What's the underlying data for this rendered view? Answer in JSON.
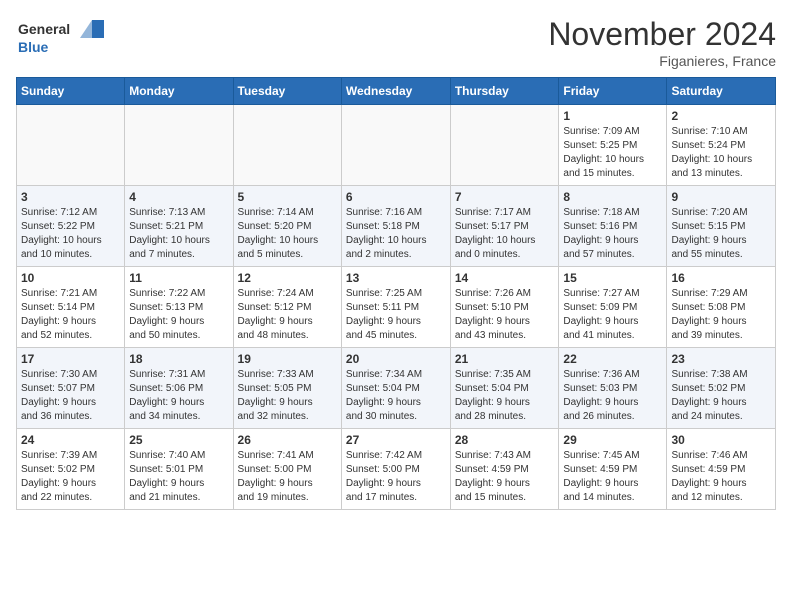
{
  "header": {
    "logo_line1": "General",
    "logo_line2": "Blue",
    "month": "November 2024",
    "location": "Figanieres, France"
  },
  "days_of_week": [
    "Sunday",
    "Monday",
    "Tuesday",
    "Wednesday",
    "Thursday",
    "Friday",
    "Saturday"
  ],
  "weeks": [
    [
      {
        "day": "",
        "info": ""
      },
      {
        "day": "",
        "info": ""
      },
      {
        "day": "",
        "info": ""
      },
      {
        "day": "",
        "info": ""
      },
      {
        "day": "",
        "info": ""
      },
      {
        "day": "1",
        "info": "Sunrise: 7:09 AM\nSunset: 5:25 PM\nDaylight: 10 hours\nand 15 minutes."
      },
      {
        "day": "2",
        "info": "Sunrise: 7:10 AM\nSunset: 5:24 PM\nDaylight: 10 hours\nand 13 minutes."
      }
    ],
    [
      {
        "day": "3",
        "info": "Sunrise: 7:12 AM\nSunset: 5:22 PM\nDaylight: 10 hours\nand 10 minutes."
      },
      {
        "day": "4",
        "info": "Sunrise: 7:13 AM\nSunset: 5:21 PM\nDaylight: 10 hours\nand 7 minutes."
      },
      {
        "day": "5",
        "info": "Sunrise: 7:14 AM\nSunset: 5:20 PM\nDaylight: 10 hours\nand 5 minutes."
      },
      {
        "day": "6",
        "info": "Sunrise: 7:16 AM\nSunset: 5:18 PM\nDaylight: 10 hours\nand 2 minutes."
      },
      {
        "day": "7",
        "info": "Sunrise: 7:17 AM\nSunset: 5:17 PM\nDaylight: 10 hours\nand 0 minutes."
      },
      {
        "day": "8",
        "info": "Sunrise: 7:18 AM\nSunset: 5:16 PM\nDaylight: 9 hours\nand 57 minutes."
      },
      {
        "day": "9",
        "info": "Sunrise: 7:20 AM\nSunset: 5:15 PM\nDaylight: 9 hours\nand 55 minutes."
      }
    ],
    [
      {
        "day": "10",
        "info": "Sunrise: 7:21 AM\nSunset: 5:14 PM\nDaylight: 9 hours\nand 52 minutes."
      },
      {
        "day": "11",
        "info": "Sunrise: 7:22 AM\nSunset: 5:13 PM\nDaylight: 9 hours\nand 50 minutes."
      },
      {
        "day": "12",
        "info": "Sunrise: 7:24 AM\nSunset: 5:12 PM\nDaylight: 9 hours\nand 48 minutes."
      },
      {
        "day": "13",
        "info": "Sunrise: 7:25 AM\nSunset: 5:11 PM\nDaylight: 9 hours\nand 45 minutes."
      },
      {
        "day": "14",
        "info": "Sunrise: 7:26 AM\nSunset: 5:10 PM\nDaylight: 9 hours\nand 43 minutes."
      },
      {
        "day": "15",
        "info": "Sunrise: 7:27 AM\nSunset: 5:09 PM\nDaylight: 9 hours\nand 41 minutes."
      },
      {
        "day": "16",
        "info": "Sunrise: 7:29 AM\nSunset: 5:08 PM\nDaylight: 9 hours\nand 39 minutes."
      }
    ],
    [
      {
        "day": "17",
        "info": "Sunrise: 7:30 AM\nSunset: 5:07 PM\nDaylight: 9 hours\nand 36 minutes."
      },
      {
        "day": "18",
        "info": "Sunrise: 7:31 AM\nSunset: 5:06 PM\nDaylight: 9 hours\nand 34 minutes."
      },
      {
        "day": "19",
        "info": "Sunrise: 7:33 AM\nSunset: 5:05 PM\nDaylight: 9 hours\nand 32 minutes."
      },
      {
        "day": "20",
        "info": "Sunrise: 7:34 AM\nSunset: 5:04 PM\nDaylight: 9 hours\nand 30 minutes."
      },
      {
        "day": "21",
        "info": "Sunrise: 7:35 AM\nSunset: 5:04 PM\nDaylight: 9 hours\nand 28 minutes."
      },
      {
        "day": "22",
        "info": "Sunrise: 7:36 AM\nSunset: 5:03 PM\nDaylight: 9 hours\nand 26 minutes."
      },
      {
        "day": "23",
        "info": "Sunrise: 7:38 AM\nSunset: 5:02 PM\nDaylight: 9 hours\nand 24 minutes."
      }
    ],
    [
      {
        "day": "24",
        "info": "Sunrise: 7:39 AM\nSunset: 5:02 PM\nDaylight: 9 hours\nand 22 minutes."
      },
      {
        "day": "25",
        "info": "Sunrise: 7:40 AM\nSunset: 5:01 PM\nDaylight: 9 hours\nand 21 minutes."
      },
      {
        "day": "26",
        "info": "Sunrise: 7:41 AM\nSunset: 5:00 PM\nDaylight: 9 hours\nand 19 minutes."
      },
      {
        "day": "27",
        "info": "Sunrise: 7:42 AM\nSunset: 5:00 PM\nDaylight: 9 hours\nand 17 minutes."
      },
      {
        "day": "28",
        "info": "Sunrise: 7:43 AM\nSunset: 4:59 PM\nDaylight: 9 hours\nand 15 minutes."
      },
      {
        "day": "29",
        "info": "Sunrise: 7:45 AM\nSunset: 4:59 PM\nDaylight: 9 hours\nand 14 minutes."
      },
      {
        "day": "30",
        "info": "Sunrise: 7:46 AM\nSunset: 4:59 PM\nDaylight: 9 hours\nand 12 minutes."
      }
    ]
  ]
}
